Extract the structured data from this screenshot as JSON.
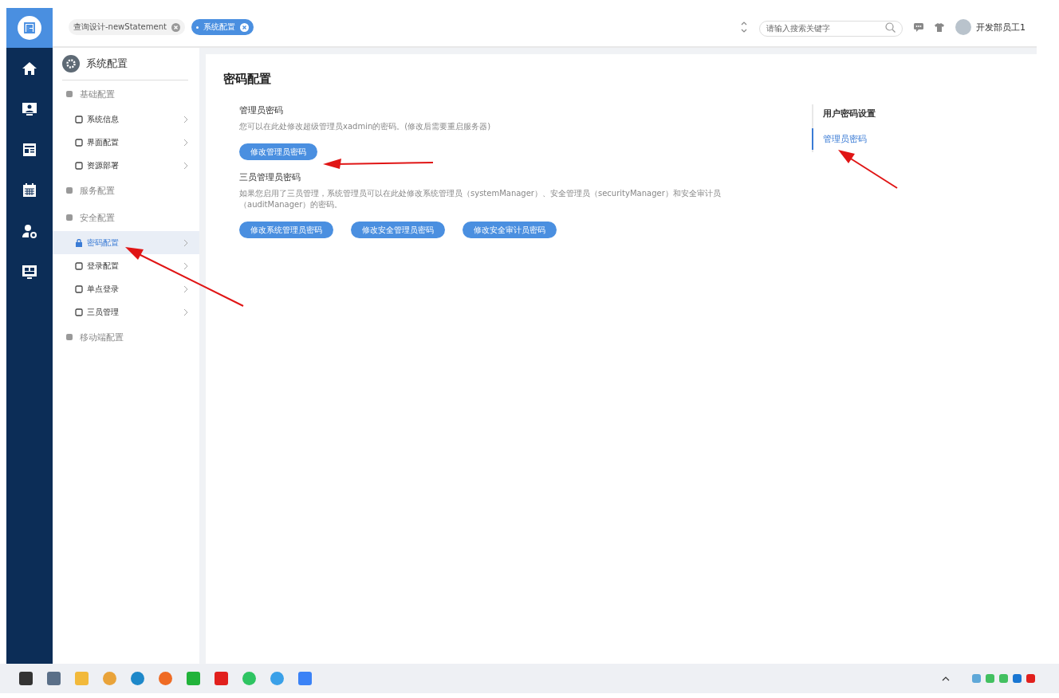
{
  "tabs": [
    {
      "label": "查询设计-newStatement",
      "selected": false
    },
    {
      "label": "系统配置",
      "selected": true
    }
  ],
  "header": {
    "search": {
      "placeholder": "请输入搜索关键字"
    },
    "user_name": "开发部员工1"
  },
  "sidebar": {
    "title": "系统配置",
    "items": [
      {
        "label": "基础配置",
        "children": [
          {
            "label": "系统信息",
            "selected": false
          },
          {
            "label": "界面配置",
            "selected": false
          },
          {
            "label": "资源部署",
            "selected": false
          }
        ]
      },
      {
        "label": "服务配置"
      },
      {
        "label": "安全配置",
        "children": [
          {
            "label": "密码配置",
            "selected": true
          },
          {
            "label": "登录配置",
            "selected": false
          },
          {
            "label": "单点登录",
            "selected": false
          },
          {
            "label": "三员管理",
            "selected": false
          }
        ]
      },
      {
        "label": "移动端配置"
      }
    ]
  },
  "content": {
    "title": "密码配置",
    "sections": [
      {
        "heading": "管理员密码",
        "description": "您可以在此处修改超级管理员xadmin的密码。(修改后需要重启服务器)",
        "buttons": [
          "修改管理员密码"
        ]
      },
      {
        "heading": "三员管理员密码",
        "description": "如果您启用了三员管理，系统管理员可以在此处修改系统管理员（systemManager）、安全管理员（securityManager）和安全审计员（auditManager）的密码。",
        "buttons": [
          "修改系统管理员密码",
          "修改安全管理员密码",
          "修改安全审计员密码"
        ]
      }
    ]
  },
  "anchor_nav": {
    "title": "用户密码设置",
    "items": [
      {
        "label": "管理员密码",
        "selected": true
      }
    ]
  }
}
